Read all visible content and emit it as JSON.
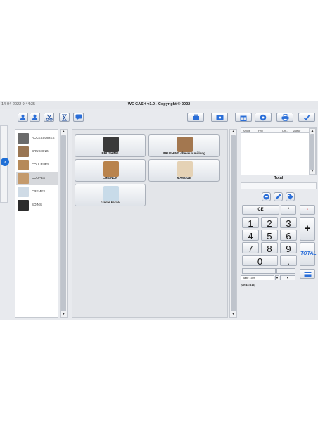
{
  "window": {
    "datetime": "14-04-2022 9:44:35",
    "title": "WE CASH v1.0 - Copyright © 2022"
  },
  "toolbar_left": [
    {
      "icon": "user-add-icon"
    },
    {
      "icon": "user-icon"
    },
    {
      "icon": "scissors-icon"
    },
    {
      "icon": "hourglass-icon"
    },
    {
      "icon": "chat-icon"
    }
  ],
  "toolbar_right": [
    {
      "icon": "cash-register-icon"
    },
    {
      "icon": "cash-icon"
    },
    {
      "icon": "gift-icon"
    },
    {
      "icon": "settings-icon"
    },
    {
      "icon": "printer-icon"
    },
    {
      "icon": "check-icon"
    }
  ],
  "categories": [
    {
      "label": "ACCESSOIRES",
      "color": "#6b6b6b"
    },
    {
      "label": "BRUSHING",
      "color": "#9a7653"
    },
    {
      "label": "COULEURS",
      "color": "#b68a5a"
    },
    {
      "label": "COUPES",
      "color": "#c49a6c"
    },
    {
      "label": "CREMES",
      "color": "#cfdbe6"
    },
    {
      "label": "SOINS",
      "color": "#2c2c2c"
    }
  ],
  "selected_category": "COUPES",
  "products": [
    {
      "label": "BRUSHING",
      "color": "#3a3a3a"
    },
    {
      "label": "BRUSHING cheveux mi-long",
      "color": "#a3774f"
    },
    {
      "label": "CHIGNON",
      "color": "#b9834c"
    },
    {
      "label": "MANGUE",
      "color": "#e5d2b5"
    },
    {
      "label": "creme karité",
      "color": "#c8dbe9"
    }
  ],
  "ticket": {
    "columns": [
      "Article",
      "Prix",
      "Uni...",
      "Valeur"
    ],
    "total_label": "Total"
  },
  "ticket_actions": [
    {
      "icon": "minus-circle-icon"
    },
    {
      "icon": "pencil-icon"
    },
    {
      "icon": "tag-icon"
    }
  ],
  "keypad": {
    "ce": "CE",
    "star": "*",
    "minus": "-",
    "plus": "+",
    "total": "TOTAL",
    "dot": ".",
    "digits": [
      "1",
      "2",
      "3",
      "4",
      "5",
      "6",
      "7",
      "8",
      "9",
      "0"
    ]
  },
  "tax": {
    "selected": "Taxe 10%"
  },
  "status": "(09:44:313)",
  "colors": {
    "accent_blue": "#1f6fd6",
    "minus_red": "#d93b3b",
    "total_blue": "#2a6ed8"
  }
}
